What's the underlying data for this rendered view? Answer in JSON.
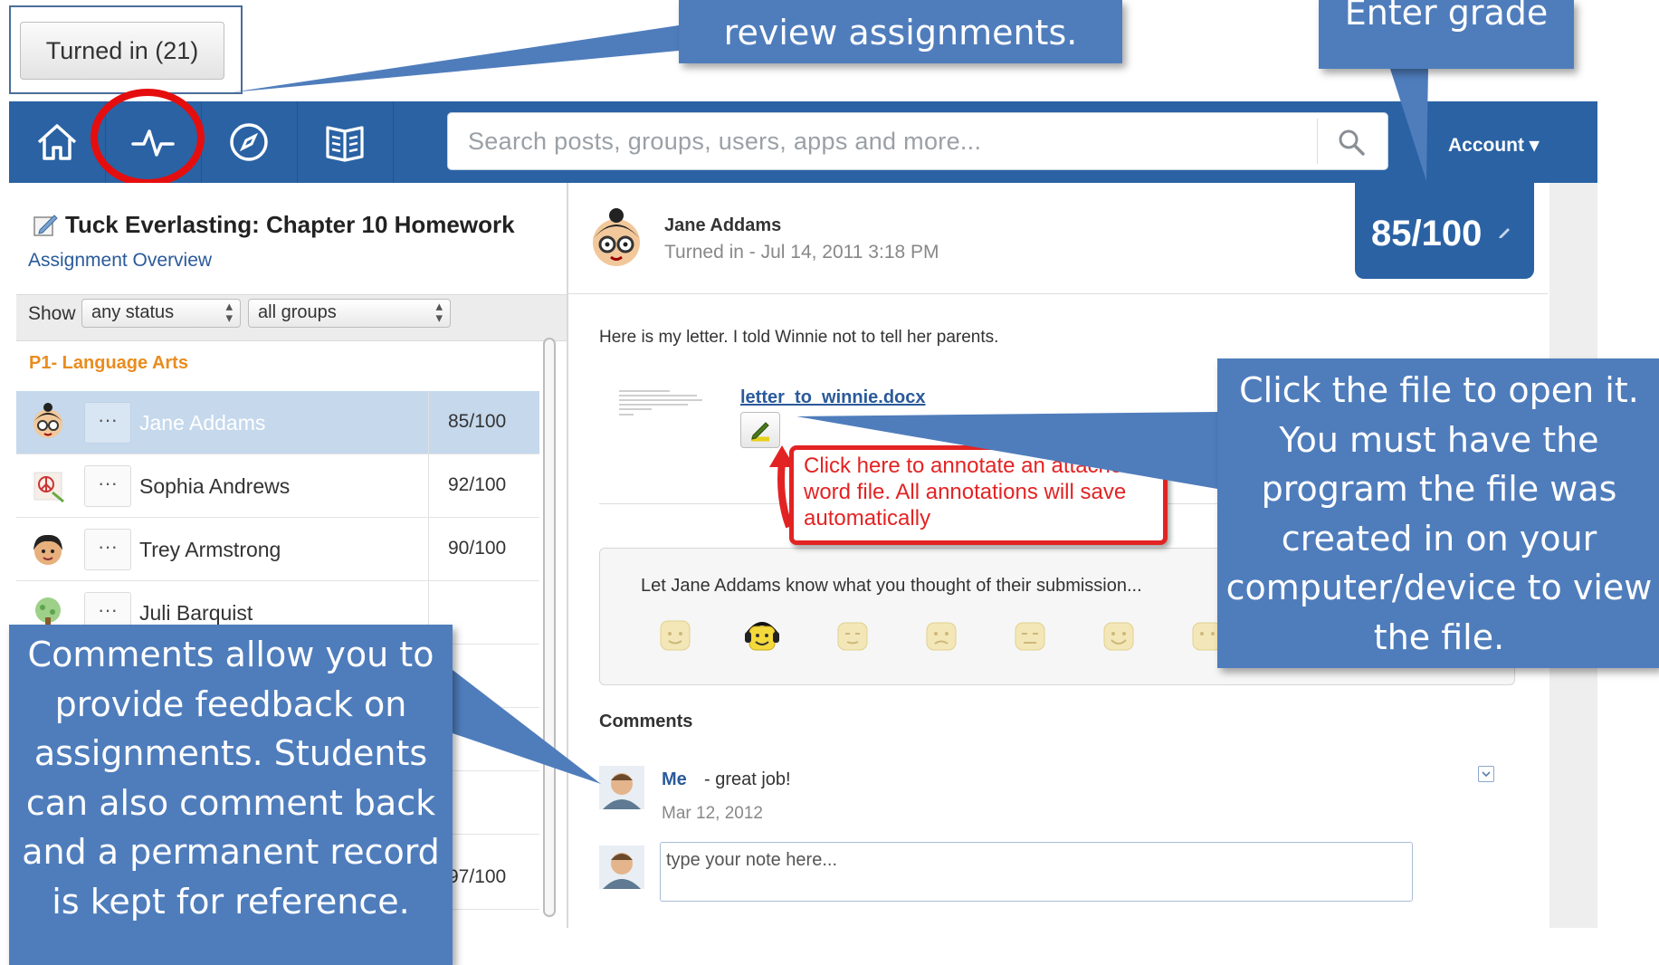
{
  "top": {
    "turned_in_label": "Turned in (21)"
  },
  "nav": {
    "icons": [
      "home-icon",
      "activity-icon",
      "compass-icon",
      "book-icon"
    ],
    "search_placeholder": "Search posts, groups, users, apps and more...",
    "account_label": "Account ▾"
  },
  "assignment": {
    "title": "Tuck Everlasting: Chapter 10 Homework",
    "overview_link": "Assignment Overview",
    "show_label": "Show",
    "status_filter": "any status",
    "group_filter": "all groups",
    "group_name": "P1- Language Arts",
    "students": [
      {
        "name": "Jane Addams",
        "grade": "85/100"
      },
      {
        "name": "Sophia Andrews",
        "grade": "92/100"
      },
      {
        "name": "Trey Armstrong",
        "grade": "90/100"
      },
      {
        "name": "Juli Barquist",
        "grade": ""
      }
    ],
    "partial_grade": "97/100"
  },
  "submission": {
    "student_name": "Jane Addams",
    "turned_in": "Turned in - Jul 14, 2011 3:18 PM",
    "grade": "85/100",
    "text": "Here is my letter. I told Winnie not to tell her parents.",
    "file_name": "letter_to_winnie.docx",
    "reaction_prompt": "Let Jane Addams know what you thought of their submission...",
    "comments_heading": "Comments",
    "comment": {
      "author": "Me",
      "text": "- great job!",
      "date": "Mar 12, 2012"
    },
    "note_placeholder": "type your note here..."
  },
  "callouts": {
    "top": "review assignments.",
    "grade": "Enter grade",
    "annotate": "Click here to annotate an attached word file. All annotations will save automatically",
    "file": "Click the file to open it. You must have the program the file was created in on your computer/device to view the file.",
    "comments": "Comments allow you to provide feedback on assignments.  Students can also comment back and a permanent record is kept for reference."
  },
  "colors": {
    "nav_blue": "#2a62a4",
    "callout_blue": "#4f7dbc",
    "highlight_red": "#e50e0e",
    "group_orange": "#e98c1e"
  }
}
